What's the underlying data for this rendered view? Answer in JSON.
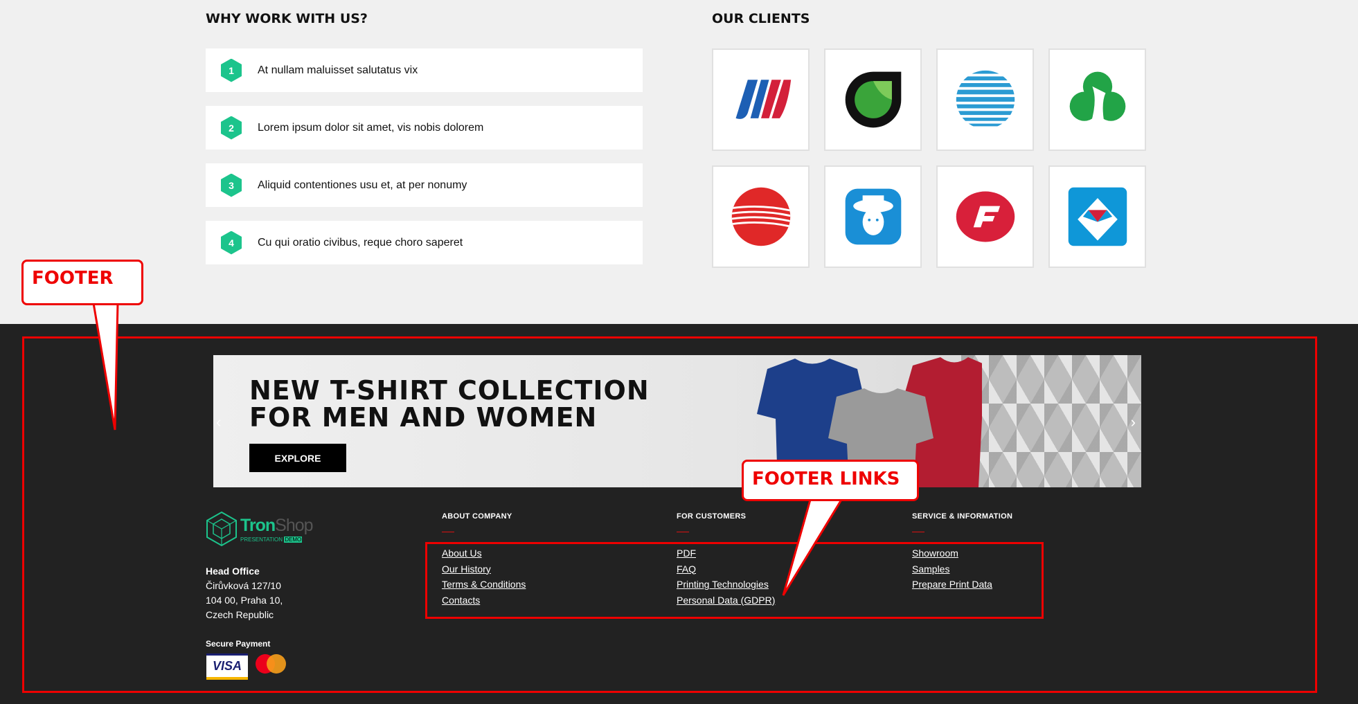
{
  "why": {
    "title": "WHY WORK WITH US?",
    "items": [
      {
        "num": "1",
        "text": "At nullam maluisset salutatus vix"
      },
      {
        "num": "2",
        "text": "Lorem ipsum dolor sit amet, vis nobis dolorem"
      },
      {
        "num": "3",
        "text": "Aliquid contentiones usu et, at per nonumy"
      },
      {
        "num": "4",
        "text": "Cu qui oratio civibus, reque choro saperet"
      }
    ]
  },
  "clients": {
    "title": "OUR CLIENTS",
    "logos": [
      "united-airlines-logo",
      "bp-style-logo",
      "att-globe-logo",
      "girl-scouts-logo",
      "red-globe-logo",
      "quaker-logo",
      "red-f-logo",
      "blue-diamond-logo"
    ]
  },
  "banner": {
    "title": "NEW  T-SHIRT COLLECTION\nFOR MEN AND WOMEN",
    "button": "EXPLORE",
    "prev": "‹",
    "next": "›"
  },
  "footer": {
    "logo": {
      "name_a": "Tron",
      "name_b": "Shop",
      "sub_a": "PRESENTATION",
      "sub_b": "DEMO"
    },
    "office": {
      "title": "Head Office",
      "line1": "Čirůvková 127/10",
      "line2": "104 00, Praha 10,",
      "line3": "Czech Republic"
    },
    "secure_payment": "Secure Payment",
    "visa": "VISA",
    "columns": [
      {
        "title": "ABOUT COMPANY",
        "links": [
          "About Us",
          "Our History",
          "Terms & Conditions",
          "Contacts"
        ]
      },
      {
        "title": "FOR CUSTOMERS",
        "links": [
          "PDF",
          "FAQ",
          "Printing Technologies",
          "Personal Data (GDPR)"
        ]
      },
      {
        "title": "SERVICE & INFORMATION",
        "links": [
          "Showroom",
          "Samples",
          "Prepare Print Data"
        ]
      }
    ]
  },
  "annotations": {
    "footer_label": "FOOTER",
    "links_label": "FOOTER LINKS",
    "color": "#e00000"
  },
  "colors": {
    "accent": "#1cc48c",
    "footer_bg": "#222222",
    "page_bg": "#f0f0f0"
  }
}
